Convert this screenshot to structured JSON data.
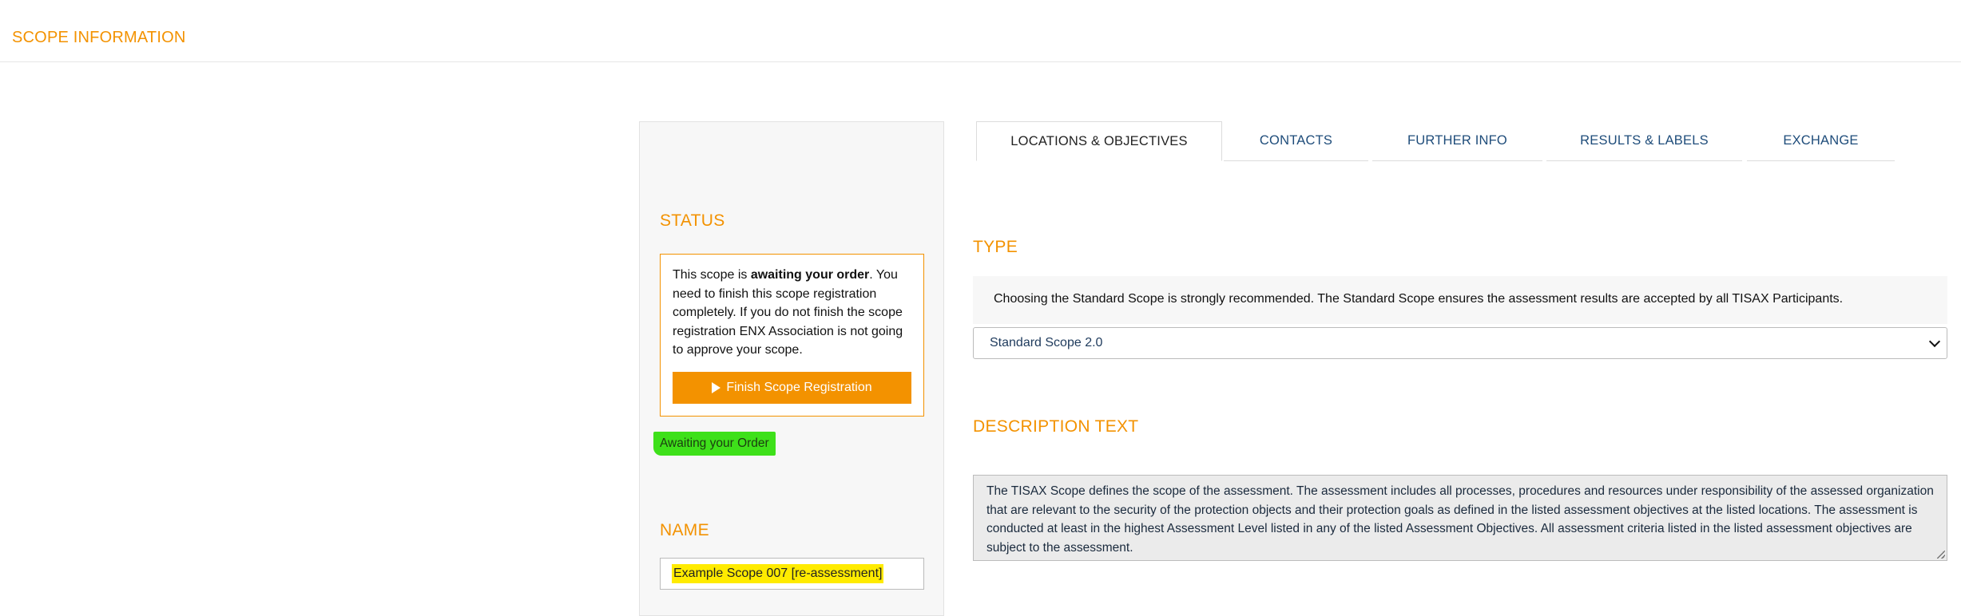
{
  "header": {
    "title": "SCOPE INFORMATION"
  },
  "status_panel": {
    "status_heading": "STATUS",
    "status_text_prefix": "This scope is ",
    "status_text_bold": "awaiting your order",
    "status_text_suffix": ". You need to finish this scope registration completely. If you do not finish the scope registration ENX Association is not going to approve your scope.",
    "finish_button_label": "Finish Scope Registration",
    "status_badge": "Awaiting your Order",
    "name_heading": "NAME",
    "name_value": "Example Scope 007 [re-assessment]"
  },
  "tabs": [
    {
      "label": "LOCATIONS & OBJECTIVES",
      "active": true
    },
    {
      "label": "CONTACTS",
      "active": false
    },
    {
      "label": "FURTHER INFO",
      "active": false
    },
    {
      "label": "RESULTS & LABELS",
      "active": false
    },
    {
      "label": "EXCHANGE",
      "active": false
    }
  ],
  "type_section": {
    "heading": "TYPE",
    "note": "Choosing the Standard Scope is strongly recommended. The Standard Scope ensures the assessment results are accepted by all TISAX Participants.",
    "selected": "Standard Scope 2.0"
  },
  "description_section": {
    "heading": "DESCRIPTION TEXT",
    "text": "The TISAX Scope defines the scope of the assessment. The assessment includes all processes, procedures and resources under responsibility of the assessed organization that are relevant to the security of the protection objects and their protection goals as defined in the listed assessment objectives at the listed locations. The assessment is conducted at least in the highest Assessment Level listed in any of the listed Assessment Objectives. All assessment criteria listed in the listed assessment objectives are subject to the assessment."
  },
  "colors": {
    "accent": "#f39200",
    "badge_green": "#3ee01a",
    "highlight_yellow": "#ffeb00",
    "link_blue": "#1e4c7a"
  }
}
